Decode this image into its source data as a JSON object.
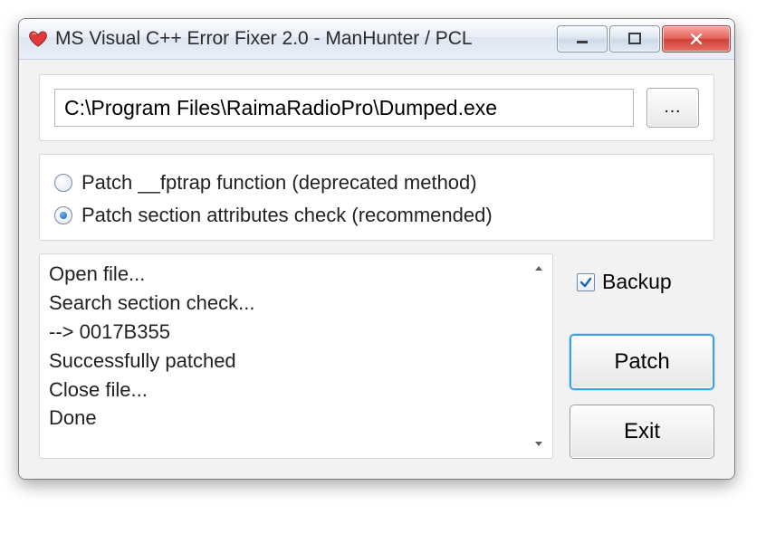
{
  "window": {
    "title": "MS Visual C++ Error Fixer 2.0 - ManHunter / PCL"
  },
  "file": {
    "path": "C:\\Program Files\\RaimaRadioPro\\Dumped.exe",
    "browse_label": "..."
  },
  "options": {
    "radio1": "Patch __fptrap function (deprecated method)",
    "radio2": "Patch section attributes check (recommended)",
    "selected": 2
  },
  "log": {
    "lines": "Open file...\nSearch section check...\n--> 0017B355\nSuccessfully patched\nClose file...\nDone"
  },
  "side": {
    "backup_label": "Backup",
    "backup_checked": true,
    "patch_label": "Patch",
    "exit_label": "Exit"
  }
}
